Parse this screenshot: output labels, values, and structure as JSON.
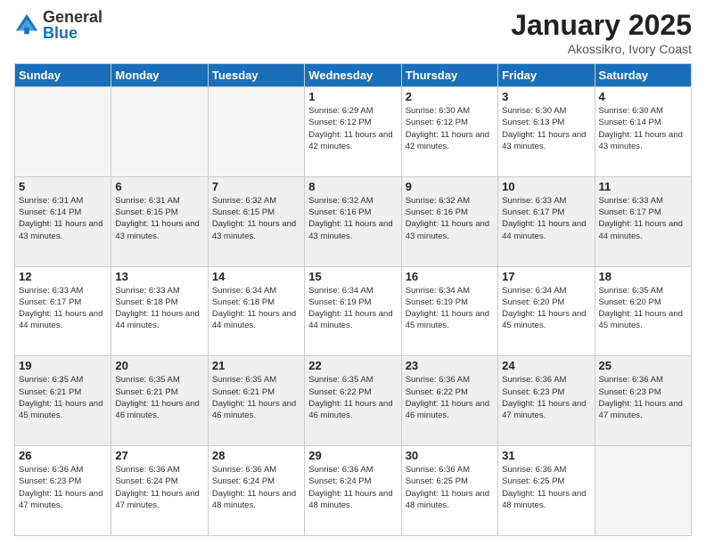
{
  "header": {
    "logo_general": "General",
    "logo_blue": "Blue",
    "month_title": "January 2025",
    "subtitle": "Akossikro, Ivory Coast"
  },
  "weekdays": [
    "Sunday",
    "Monday",
    "Tuesday",
    "Wednesday",
    "Thursday",
    "Friday",
    "Saturday"
  ],
  "weeks": [
    [
      {
        "day": "",
        "sunrise": "",
        "sunset": "",
        "daylight": ""
      },
      {
        "day": "",
        "sunrise": "",
        "sunset": "",
        "daylight": ""
      },
      {
        "day": "",
        "sunrise": "",
        "sunset": "",
        "daylight": ""
      },
      {
        "day": "1",
        "sunrise": "Sunrise: 6:29 AM",
        "sunset": "Sunset: 6:12 PM",
        "daylight": "Daylight: 11 hours and 42 minutes."
      },
      {
        "day": "2",
        "sunrise": "Sunrise: 6:30 AM",
        "sunset": "Sunset: 6:12 PM",
        "daylight": "Daylight: 11 hours and 42 minutes."
      },
      {
        "day": "3",
        "sunrise": "Sunrise: 6:30 AM",
        "sunset": "Sunset: 6:13 PM",
        "daylight": "Daylight: 11 hours and 43 minutes."
      },
      {
        "day": "4",
        "sunrise": "Sunrise: 6:30 AM",
        "sunset": "Sunset: 6:14 PM",
        "daylight": "Daylight: 11 hours and 43 minutes."
      }
    ],
    [
      {
        "day": "5",
        "sunrise": "Sunrise: 6:31 AM",
        "sunset": "Sunset: 6:14 PM",
        "daylight": "Daylight: 11 hours and 43 minutes."
      },
      {
        "day": "6",
        "sunrise": "Sunrise: 6:31 AM",
        "sunset": "Sunset: 6:15 PM",
        "daylight": "Daylight: 11 hours and 43 minutes."
      },
      {
        "day": "7",
        "sunrise": "Sunrise: 6:32 AM",
        "sunset": "Sunset: 6:15 PM",
        "daylight": "Daylight: 11 hours and 43 minutes."
      },
      {
        "day": "8",
        "sunrise": "Sunrise: 6:32 AM",
        "sunset": "Sunset: 6:16 PM",
        "daylight": "Daylight: 11 hours and 43 minutes."
      },
      {
        "day": "9",
        "sunrise": "Sunrise: 6:32 AM",
        "sunset": "Sunset: 6:16 PM",
        "daylight": "Daylight: 11 hours and 43 minutes."
      },
      {
        "day": "10",
        "sunrise": "Sunrise: 6:33 AM",
        "sunset": "Sunset: 6:17 PM",
        "daylight": "Daylight: 11 hours and 44 minutes."
      },
      {
        "day": "11",
        "sunrise": "Sunrise: 6:33 AM",
        "sunset": "Sunset: 6:17 PM",
        "daylight": "Daylight: 11 hours and 44 minutes."
      }
    ],
    [
      {
        "day": "12",
        "sunrise": "Sunrise: 6:33 AM",
        "sunset": "Sunset: 6:17 PM",
        "daylight": "Daylight: 11 hours and 44 minutes."
      },
      {
        "day": "13",
        "sunrise": "Sunrise: 6:33 AM",
        "sunset": "Sunset: 6:18 PM",
        "daylight": "Daylight: 11 hours and 44 minutes."
      },
      {
        "day": "14",
        "sunrise": "Sunrise: 6:34 AM",
        "sunset": "Sunset: 6:18 PM",
        "daylight": "Daylight: 11 hours and 44 minutes."
      },
      {
        "day": "15",
        "sunrise": "Sunrise: 6:34 AM",
        "sunset": "Sunset: 6:19 PM",
        "daylight": "Daylight: 11 hours and 44 minutes."
      },
      {
        "day": "16",
        "sunrise": "Sunrise: 6:34 AM",
        "sunset": "Sunset: 6:19 PM",
        "daylight": "Daylight: 11 hours and 45 minutes."
      },
      {
        "day": "17",
        "sunrise": "Sunrise: 6:34 AM",
        "sunset": "Sunset: 6:20 PM",
        "daylight": "Daylight: 11 hours and 45 minutes."
      },
      {
        "day": "18",
        "sunrise": "Sunrise: 6:35 AM",
        "sunset": "Sunset: 6:20 PM",
        "daylight": "Daylight: 11 hours and 45 minutes."
      }
    ],
    [
      {
        "day": "19",
        "sunrise": "Sunrise: 6:35 AM",
        "sunset": "Sunset: 6:21 PM",
        "daylight": "Daylight: 11 hours and 45 minutes."
      },
      {
        "day": "20",
        "sunrise": "Sunrise: 6:35 AM",
        "sunset": "Sunset: 6:21 PM",
        "daylight": "Daylight: 11 hours and 46 minutes."
      },
      {
        "day": "21",
        "sunrise": "Sunrise: 6:35 AM",
        "sunset": "Sunset: 6:21 PM",
        "daylight": "Daylight: 11 hours and 46 minutes."
      },
      {
        "day": "22",
        "sunrise": "Sunrise: 6:35 AM",
        "sunset": "Sunset: 6:22 PM",
        "daylight": "Daylight: 11 hours and 46 minutes."
      },
      {
        "day": "23",
        "sunrise": "Sunrise: 6:36 AM",
        "sunset": "Sunset: 6:22 PM",
        "daylight": "Daylight: 11 hours and 46 minutes."
      },
      {
        "day": "24",
        "sunrise": "Sunrise: 6:36 AM",
        "sunset": "Sunset: 6:23 PM",
        "daylight": "Daylight: 11 hours and 47 minutes."
      },
      {
        "day": "25",
        "sunrise": "Sunrise: 6:36 AM",
        "sunset": "Sunset: 6:23 PM",
        "daylight": "Daylight: 11 hours and 47 minutes."
      }
    ],
    [
      {
        "day": "26",
        "sunrise": "Sunrise: 6:36 AM",
        "sunset": "Sunset: 6:23 PM",
        "daylight": "Daylight: 11 hours and 47 minutes."
      },
      {
        "day": "27",
        "sunrise": "Sunrise: 6:36 AM",
        "sunset": "Sunset: 6:24 PM",
        "daylight": "Daylight: 11 hours and 47 minutes."
      },
      {
        "day": "28",
        "sunrise": "Sunrise: 6:36 AM",
        "sunset": "Sunset: 6:24 PM",
        "daylight": "Daylight: 11 hours and 48 minutes."
      },
      {
        "day": "29",
        "sunrise": "Sunrise: 6:36 AM",
        "sunset": "Sunset: 6:24 PM",
        "daylight": "Daylight: 11 hours and 48 minutes."
      },
      {
        "day": "30",
        "sunrise": "Sunrise: 6:36 AM",
        "sunset": "Sunset: 6:25 PM",
        "daylight": "Daylight: 11 hours and 48 minutes."
      },
      {
        "day": "31",
        "sunrise": "Sunrise: 6:36 AM",
        "sunset": "Sunset: 6:25 PM",
        "daylight": "Daylight: 11 hours and 48 minutes."
      },
      {
        "day": "",
        "sunrise": "",
        "sunset": "",
        "daylight": ""
      }
    ]
  ]
}
